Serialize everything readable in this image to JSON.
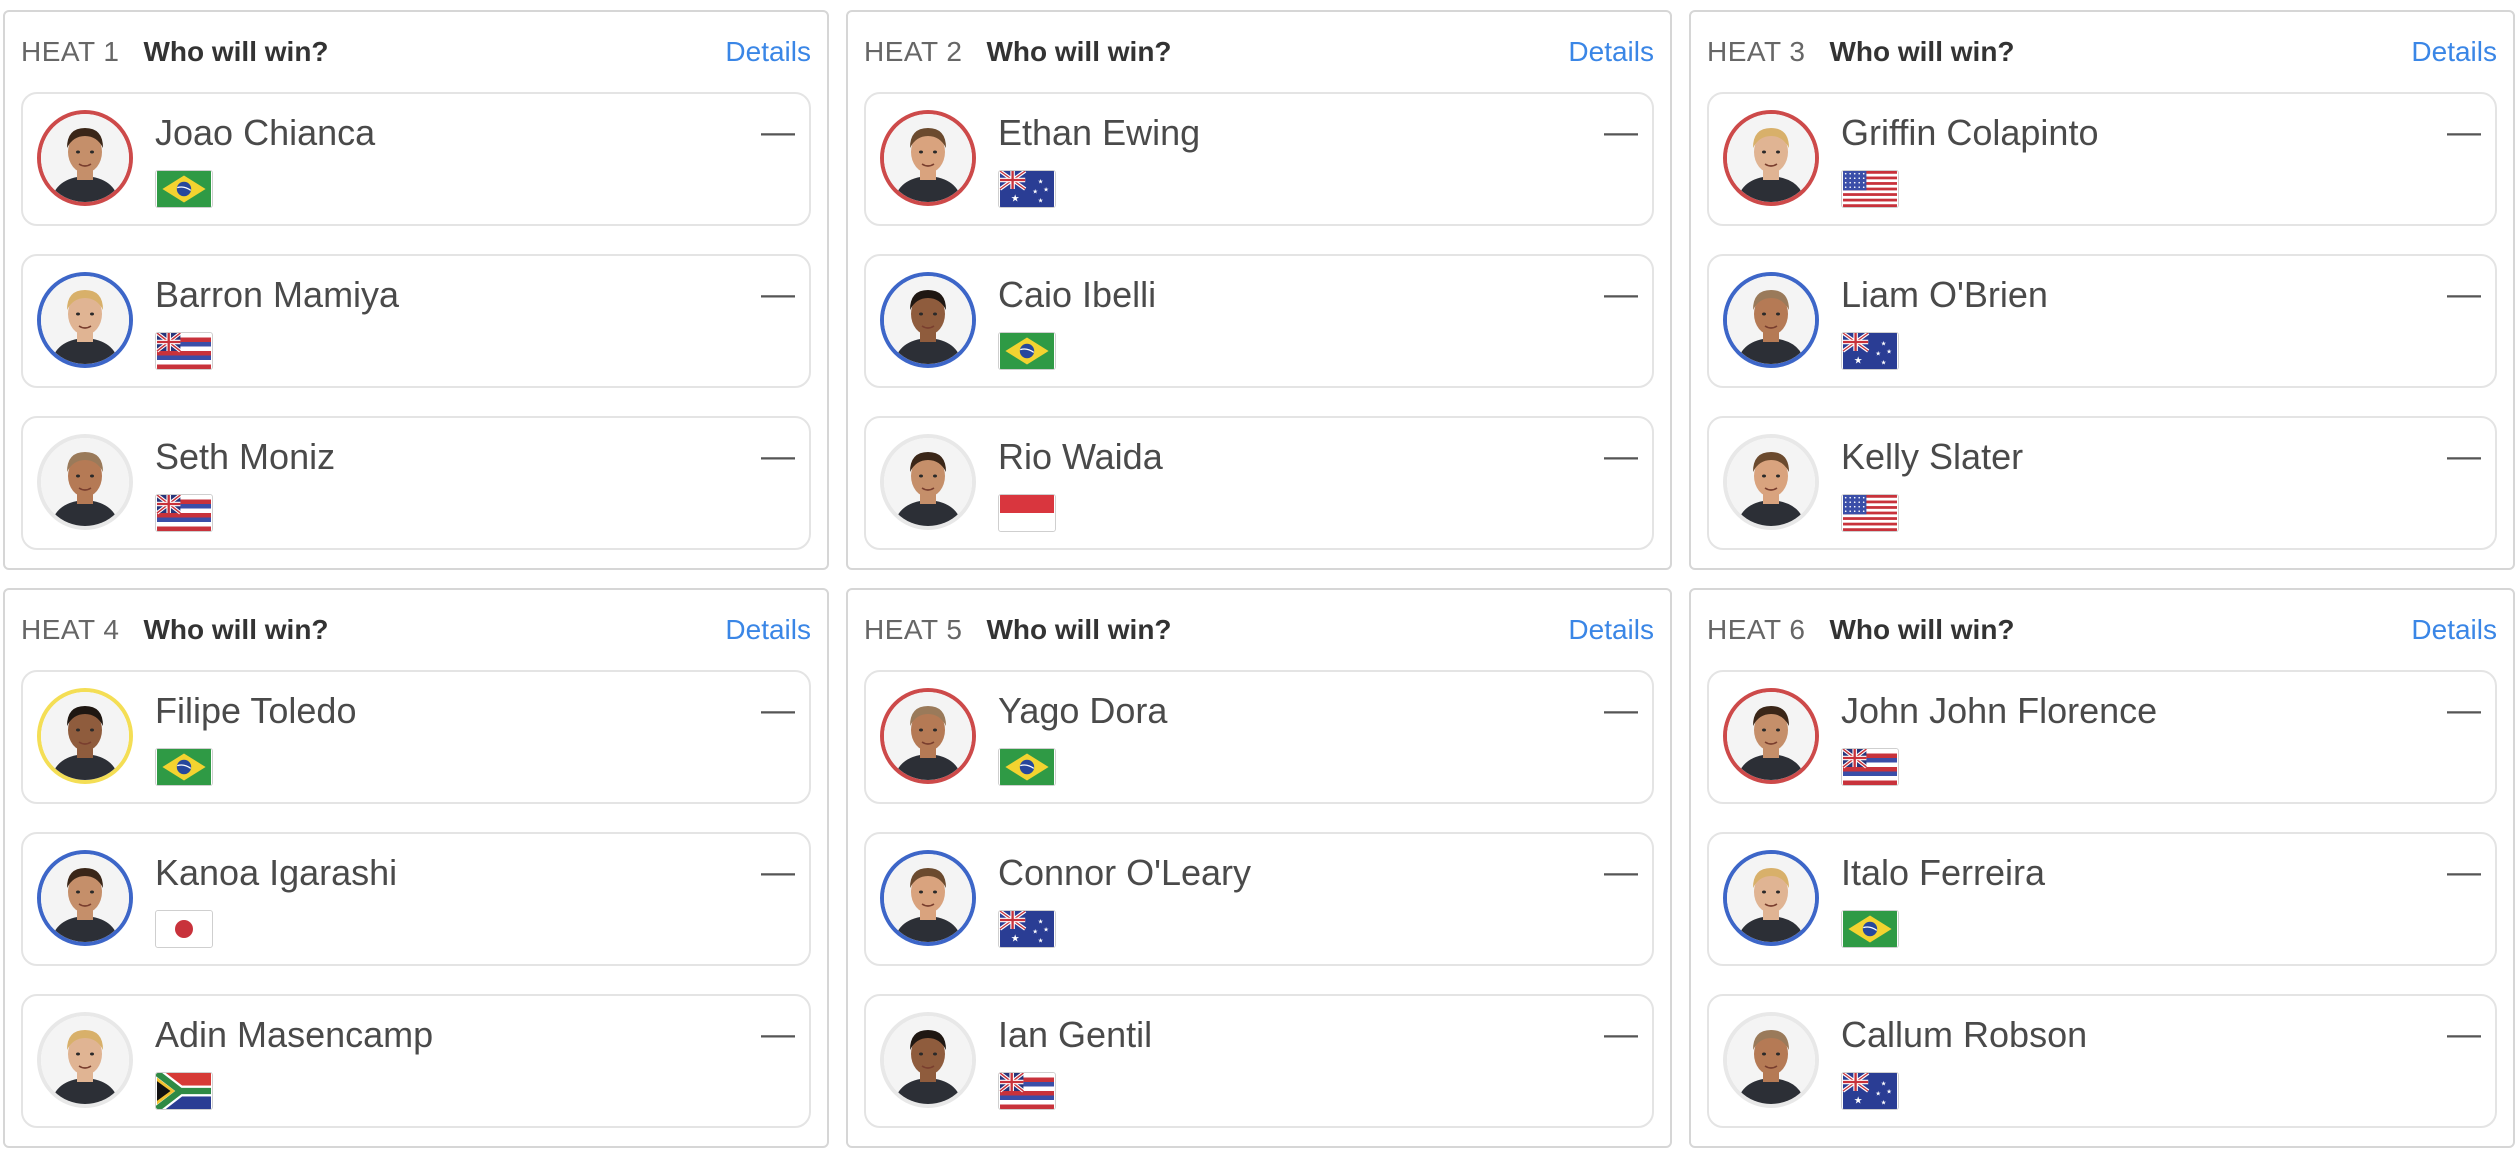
{
  "colors": {
    "red_ring": "#cd4a4a",
    "blue_ring": "#3d66c8",
    "yellow_ring": "#f4de55",
    "neutral_ring": "#e8e8e8",
    "link": "#3a86e6"
  },
  "heats": [
    {
      "label": "HEAT 1",
      "question": "Who will win?",
      "details_label": "Details",
      "surfers": [
        {
          "name": "Joao Chianca",
          "flag": "flag-brazil-icon",
          "ring": "red",
          "pick": "—"
        },
        {
          "name": "Barron Mamiya",
          "flag": "flag-hawaii-icon",
          "ring": "blue",
          "pick": "—"
        },
        {
          "name": "Seth Moniz",
          "flag": "flag-hawaii-icon",
          "ring": "neutral",
          "pick": "—"
        }
      ]
    },
    {
      "label": "HEAT 2",
      "question": "Who will win?",
      "details_label": "Details",
      "surfers": [
        {
          "name": "Ethan Ewing",
          "flag": "flag-australia-icon",
          "ring": "red",
          "pick": "—"
        },
        {
          "name": "Caio Ibelli",
          "flag": "flag-brazil-icon",
          "ring": "blue",
          "pick": "—"
        },
        {
          "name": "Rio Waida",
          "flag": "flag-indonesia-icon",
          "ring": "neutral",
          "pick": "—"
        }
      ]
    },
    {
      "label": "HEAT 3",
      "question": "Who will win?",
      "details_label": "Details",
      "surfers": [
        {
          "name": "Griffin Colapinto",
          "flag": "flag-usa-icon",
          "ring": "red",
          "pick": "—"
        },
        {
          "name": "Liam O'Brien",
          "flag": "flag-australia-icon",
          "ring": "blue",
          "pick": "—"
        },
        {
          "name": "Kelly Slater",
          "flag": "flag-usa-icon",
          "ring": "neutral",
          "pick": "—"
        }
      ]
    },
    {
      "label": "HEAT 4",
      "question": "Who will win?",
      "details_label": "Details",
      "surfers": [
        {
          "name": "Filipe Toledo",
          "flag": "flag-brazil-icon",
          "ring": "yellow",
          "pick": "—"
        },
        {
          "name": "Kanoa Igarashi",
          "flag": "flag-japan-icon",
          "ring": "blue",
          "pick": "—"
        },
        {
          "name": "Adin Masencamp",
          "flag": "flag-south-africa-icon",
          "ring": "neutral",
          "pick": "—"
        }
      ]
    },
    {
      "label": "HEAT 5",
      "question": "Who will win?",
      "details_label": "Details",
      "surfers": [
        {
          "name": "Yago Dora",
          "flag": "flag-brazil-icon",
          "ring": "red",
          "pick": "—"
        },
        {
          "name": "Connor O'Leary",
          "flag": "flag-australia-icon",
          "ring": "blue",
          "pick": "—"
        },
        {
          "name": "Ian Gentil",
          "flag": "flag-hawaii-icon",
          "ring": "neutral",
          "pick": "—"
        }
      ]
    },
    {
      "label": "HEAT 6",
      "question": "Who will win?",
      "details_label": "Details",
      "surfers": [
        {
          "name": "John John Florence",
          "flag": "flag-hawaii-icon",
          "ring": "red",
          "pick": "—"
        },
        {
          "name": "Italo Ferreira",
          "flag": "flag-brazil-icon",
          "ring": "blue",
          "pick": "—"
        },
        {
          "name": "Callum Robson",
          "flag": "flag-australia-icon",
          "ring": "neutral",
          "pick": "—"
        }
      ]
    }
  ]
}
